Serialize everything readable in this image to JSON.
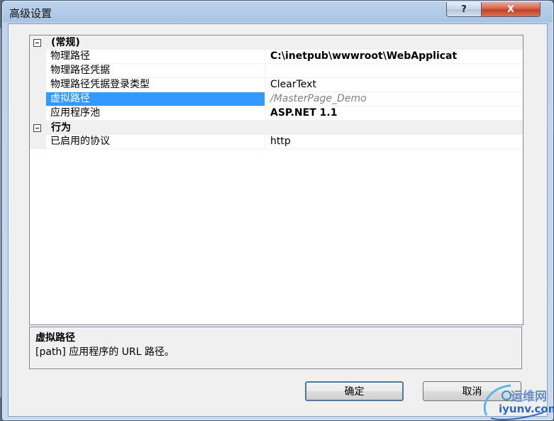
{
  "window": {
    "title": "高级设置",
    "help_label": "?",
    "close_label": "X"
  },
  "grid": {
    "categories": [
      {
        "label": "(常规)",
        "rows": [
          {
            "name": "物理路径",
            "value": "C:\\inetpub\\wwwroot\\WebApplicat"
          },
          {
            "name": "物理路径凭据",
            "value": ""
          },
          {
            "name": "物理路径凭据登录类型",
            "value": "ClearText"
          },
          {
            "name": "虚拟路径",
            "value": "/MasterPage_Demo"
          },
          {
            "name": "应用程序池",
            "value": "ASP.NET 1.1"
          }
        ]
      },
      {
        "label": "行为",
        "rows": [
          {
            "name": "已启用的协议",
            "value": "http"
          }
        ]
      }
    ]
  },
  "description": {
    "title": "虚拟路径",
    "text": "[path] 应用程序的 URL 路径。"
  },
  "buttons": {
    "ok": "确定",
    "cancel": "取消"
  },
  "watermark": {
    "line1": "运维网",
    "line2": "iyunv.com"
  }
}
